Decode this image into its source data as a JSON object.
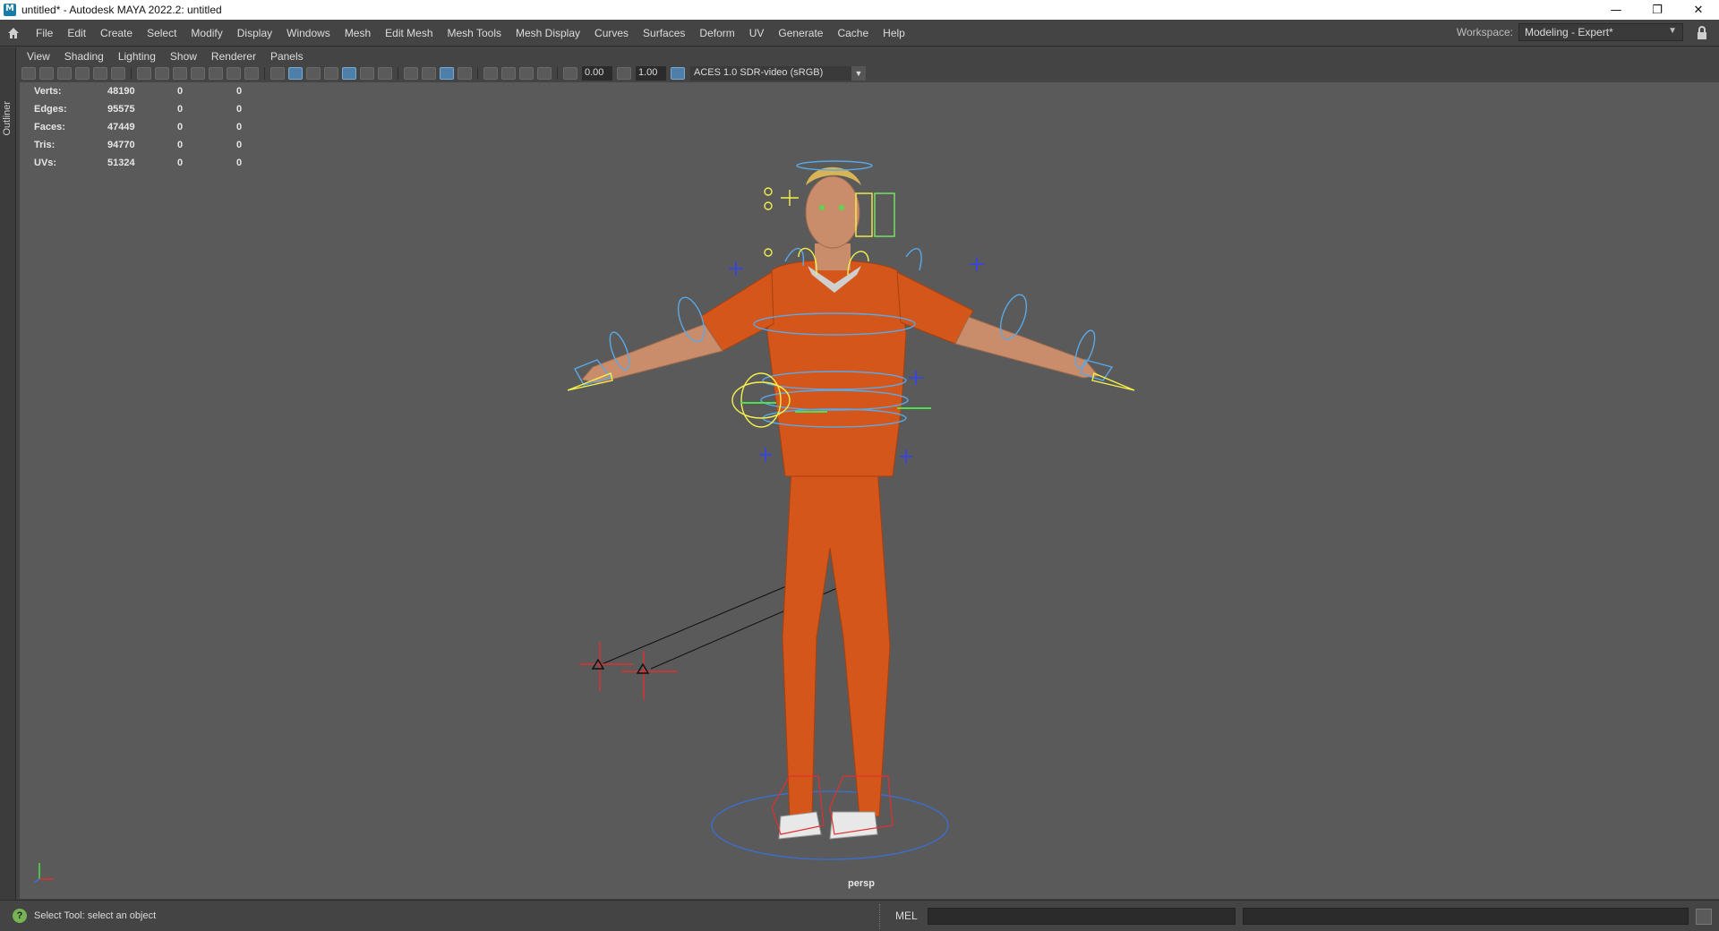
{
  "window": {
    "title": "untitled* - Autodesk MAYA 2022.2: untitled",
    "controls": {
      "minimize": "—",
      "restore": "❐",
      "close": "✕"
    }
  },
  "menubar": {
    "items": [
      "File",
      "Edit",
      "Create",
      "Select",
      "Modify",
      "Display",
      "Windows",
      "Mesh",
      "Edit Mesh",
      "Mesh Tools",
      "Mesh Display",
      "Curves",
      "Surfaces",
      "Deform",
      "UV",
      "Generate",
      "Cache",
      "Help"
    ],
    "workspace_label": "Workspace:",
    "workspace_value": "Modeling - Expert*"
  },
  "outliner": {
    "label": "Outliner"
  },
  "panel_menu": {
    "items": [
      "View",
      "Shading",
      "Lighting",
      "Show",
      "Renderer",
      "Panels"
    ]
  },
  "panel_toolbar": {
    "exposure": "0.00",
    "gamma": "1.00",
    "color_space": "ACES 1.0 SDR-video (sRGB)"
  },
  "hud": {
    "rows": [
      {
        "label": "Verts:",
        "value": "48190",
        "sel": "0",
        "uv": "0"
      },
      {
        "label": "Edges:",
        "value": "95575",
        "sel": "0",
        "uv": "0"
      },
      {
        "label": "Faces:",
        "value": "47449",
        "sel": "0",
        "uv": "0"
      },
      {
        "label": "Tris:",
        "value": "94770",
        "sel": "0",
        "uv": "0"
      },
      {
        "label": "UVs:",
        "value": "51324",
        "sel": "0",
        "uv": "0"
      }
    ]
  },
  "viewport": {
    "camera": "persp"
  },
  "statusbar": {
    "help_text": "Select Tool: select an object",
    "mel_label": "MEL"
  },
  "colors": {
    "viewport_bg": "#5a5a5a",
    "jumpsuit": "#d4561b",
    "rig_blue": "#5aa8e6",
    "rig_yellow": "#f5f04a",
    "rig_red": "#e03030"
  }
}
